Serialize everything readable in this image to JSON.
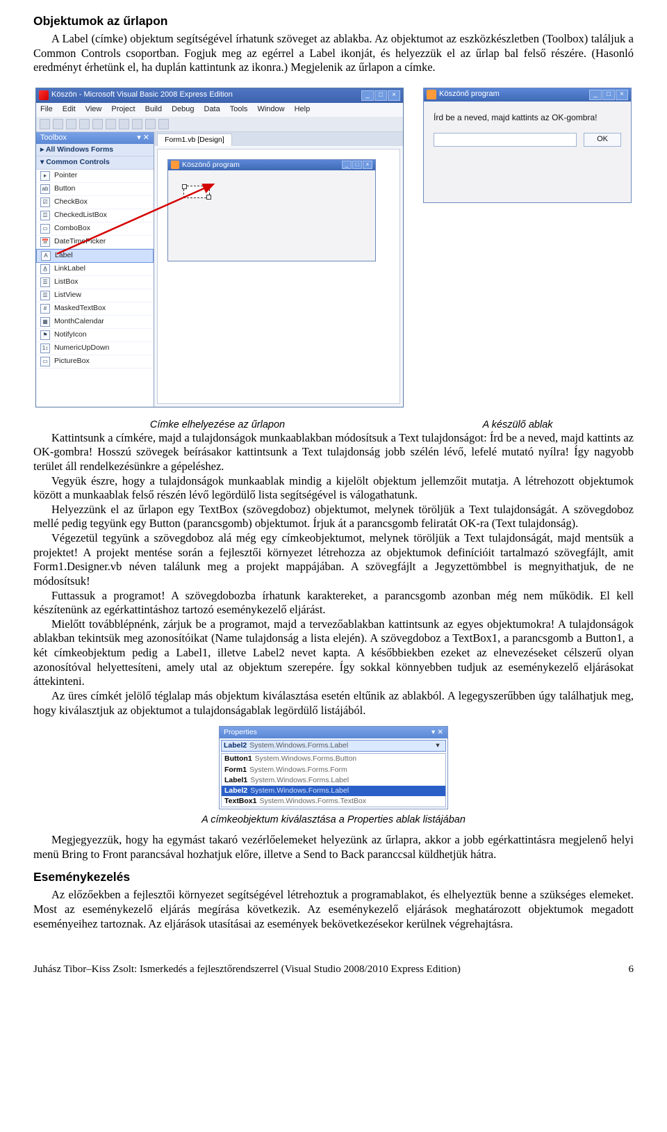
{
  "h_objects": "Objektumok az űrlapon",
  "p1": "A Label (címke) objektum segítségével írhatunk szöveget az ablakba. Az objektumot az eszközkészletben (Toolbox) találjuk a Common Controls csoportban. Fogjuk meg az egérrel a Label ikonját, és helyezzük el az űrlap bal felső részére. (Hasonló eredményt érhetünk el, ha duplán kattintunk az ikonra.) Megjelenik az űrlapon a címke.",
  "ide": {
    "title": "Köszön - Microsoft Visual Basic 2008 Express Edition",
    "menus": [
      "File",
      "Edit",
      "View",
      "Project",
      "Build",
      "Debug",
      "Data",
      "Tools",
      "Window",
      "Help"
    ],
    "toolbox_title": "Toolbox",
    "groups": [
      "All Windows Forms",
      "Common Controls"
    ],
    "items": [
      {
        "icon": "▸",
        "label": "Pointer"
      },
      {
        "icon": "ab",
        "label": "Button"
      },
      {
        "icon": "☑",
        "label": "CheckBox"
      },
      {
        "icon": "☲",
        "label": "CheckedListBox"
      },
      {
        "icon": "▭",
        "label": "ComboBox"
      },
      {
        "icon": "📅",
        "label": "DateTimePicker"
      },
      {
        "icon": "A",
        "label": "Label",
        "selected": true
      },
      {
        "icon": "A̲",
        "label": "LinkLabel"
      },
      {
        "icon": "☰",
        "label": "ListBox"
      },
      {
        "icon": "☰",
        "label": "ListView"
      },
      {
        "icon": "#",
        "label": "MaskedTextBox"
      },
      {
        "icon": "▦",
        "label": "MonthCalendar"
      },
      {
        "icon": "⚑",
        "label": "NotifyIcon"
      },
      {
        "icon": "1↕",
        "label": "NumericUpDown"
      },
      {
        "icon": "▭",
        "label": "PictureBox"
      }
    ],
    "doc_tab": "Form1.vb [Design]",
    "form_title": "Köszönő program"
  },
  "run": {
    "title": "Köszönő program",
    "label": "Írd be a neved, majd kattints az OK-gombra!",
    "button": "OK"
  },
  "cap1": "Címke elhelyezése az űrlapon",
  "cap2": "A készülő ablak",
  "p2": "Kattintsunk a címkére, majd a tulajdonságok munkaablakban módosítsuk a Text tulajdonságot: Írd be a neved, majd kattints az OK-gombra! Hosszú szövegek beírásakor kattintsunk a Text tulajdonság jobb szélén lévő, lefelé mutató nyílra! Így nagyobb terület áll rendelkezésünkre a gépeléshez.",
  "p3": "Vegyük észre, hogy a tulajdonságok munkaablak mindig a kijelölt objektum jellemzőit mutatja. A létrehozott objektumok között a munkaablak felső részén lévő legördülő lista segítségével is válogathatunk.",
  "p4": "Helyezzünk el az űrlapon egy TextBox (szövegdoboz) objektumot, melynek töröljük a Text tulajdonságát. A szövegdoboz mellé pedig tegyünk egy Button (parancsgomb) objektumot. Írjuk át a parancsgomb feliratát OK-ra (Text tulajdonság).",
  "p5": "Végezetül tegyünk a szövegdoboz alá még egy címkeobjektumot, melynek töröljük a Text tulajdonságát, majd mentsük a projektet! A projekt mentése során a fejlesztői környezet létrehozza az objektumok definícióit tartalmazó szövegfájlt, amit Form1.Designer.vb néven találunk meg a projekt mappájában. A szövegfájlt a Jegyzettömbbel is megnyithatjuk, de ne módosítsuk!",
  "p6": "Futtassuk a programot! A szövegdobozba írhatunk karaktereket, a parancsgomb azonban még nem működik. El kell készítenünk az egérkattintáshoz tartozó eseménykezelő eljárást.",
  "p7": "Mielőtt továbblépnénk, zárjuk be a programot, majd a tervezőablakban kattintsunk az egyes objektumokra! A tulajdonságok ablakban tekintsük meg azonosítóikat (Name tulajdonság a lista elején). A szövegdoboz a TextBox1, a parancsgomb a Button1, a két címkeobjektum pedig a Label1, illetve Label2 nevet kapta. A későbbiekben ezeket az elnevezéseket célszerű olyan azonosítóval helyettesíteni, amely utal az objektum szerepére. Így sokkal könnyebben tudjuk az eseménykezelő eljárásokat áttekinteni.",
  "p8": "Az üres címkét jelölő téglalap más objektum kiválasztása esetén eltűnik az ablakból. A legegyszerűbben úgy találhatjuk meg, hogy kiválasztjuk az objektumot a tulajdonságablak legördülő listájából.",
  "props": {
    "title": "Properties",
    "selected": {
      "name": "Label2",
      "type": "System.Windows.Forms.Label"
    },
    "items": [
      {
        "name": "Button1",
        "type": "System.Windows.Forms.Button"
      },
      {
        "name": "Form1",
        "type": "System.Windows.Forms.Form"
      },
      {
        "name": "Label1",
        "type": "System.Windows.Forms.Label"
      },
      {
        "name": "Label2",
        "type": "System.Windows.Forms.Label",
        "sel": true
      },
      {
        "name": "TextBox1",
        "type": "System.Windows.Forms.TextBox"
      }
    ]
  },
  "cap3": "A címkeobjektum kiválasztása a Properties ablak listájában",
  "p9": "Megjegyezzük, hogy ha egymást takaró vezérlőelemeket helyezünk az űrlapra, akkor a jobb egérkattintásra megjelenő helyi menü Bring to Front parancsával hozhatjuk előre, illetve a Send to Back paranccsal küldhetjük hátra.",
  "h_events": "Eseménykezelés",
  "p10": "Az előzőekben a fejlesztői környezet segítségével létrehoztuk a programablakot, és elhelyeztük benne a szükséges elemeket. Most az eseménykezelő eljárás megírása következik. Az eseménykezelő eljárások meghatározott objektumok megadott eseményeihez tartoznak. Az eljárások utasításai az események bekövetkezésekor kerülnek végrehajtásra.",
  "footer_left": "Juhász Tibor–Kiss Zsolt: Ismerkedés a fejlesztőrendszerrel (Visual Studio 2008/2010 Express Edition)",
  "footer_right": "6"
}
